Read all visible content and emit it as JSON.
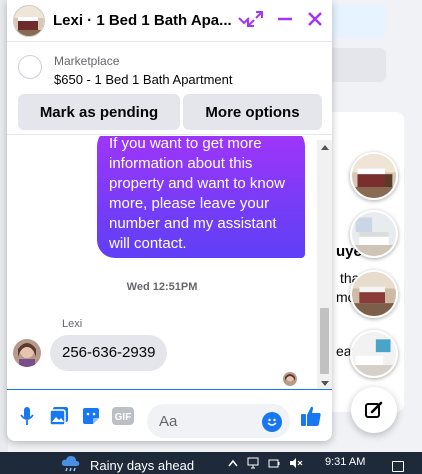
{
  "background": {
    "fragments": [
      "that",
      "mo",
      "uye",
      "ear"
    ],
    "chat_heads": [
      "bedroom-photo-icon",
      "living-room-photo-icon",
      "bedroom-photo-icon",
      "living-room-photo-icon"
    ]
  },
  "chat": {
    "title": "Lexi · 1 Bed 1 Bath Apa...",
    "marketplace": {
      "label": "Marketplace",
      "listing": "$650 - 1 Bed 1 Bath Apartment",
      "pending_button": "Mark as pending",
      "more_button": "More options"
    },
    "messages": {
      "outgoing": "If you want to get more\ninformation about this\nproperty and want to know\nmore, please leave your\nnumber and my assistant\nwill contact.",
      "timestamp": "Wed 12:51PM",
      "sender": "Lexi",
      "incoming": "256-636-2939"
    },
    "composer": {
      "placeholder": "Aa",
      "gif_label": "GIF"
    },
    "colors": {
      "accent": "#1877f2",
      "accent_purple": "#a334fa",
      "bubble_gradient_end": "#5f3ff6",
      "header_icons": "#a334fa"
    }
  },
  "taskbar": {
    "weather": "Rainy days ahead",
    "time": "9:31 AM"
  }
}
